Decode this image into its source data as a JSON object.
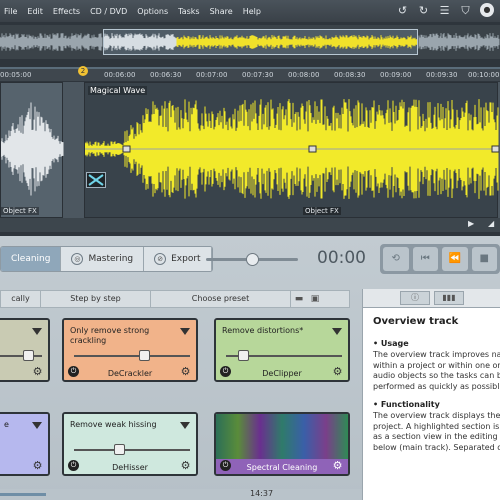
{
  "menubar": {
    "items": [
      "File",
      "Edit",
      "Effects",
      "CD / DVD",
      "Options",
      "Tasks",
      "Share",
      "Help"
    ]
  },
  "timeline": {
    "ticks": [
      "00:05:00",
      "00:06:00",
      "00:06:30",
      "00:07:00",
      "00:07:30",
      "00:08:00",
      "00:08:30",
      "00:09:00",
      "00:09:30",
      "00:10:00"
    ],
    "marker": "2"
  },
  "editor": {
    "clip1_fx": "Object FX",
    "clip2_title": "Magical Wave",
    "clip2_fx": "Object FX"
  },
  "tabs": {
    "cleaning": "Cleaning",
    "mastering": "Mastering",
    "export": "Export"
  },
  "time_display": "00:00",
  "subtabs": {
    "manually": "cally",
    "step": "Step by step",
    "preset": "Choose preset"
  },
  "cards": {
    "decrackler": {
      "title": "Only remove strong crackling",
      "label": "DeCrackler",
      "color": "#f1b38a",
      "level": 0.55
    },
    "declipper": {
      "title": "Remove distortions*",
      "label": "DeClipper",
      "color": "#b7d79a",
      "level": 0.1
    },
    "dehisser": {
      "title": "Remove weak hissing",
      "label": "DeHisser",
      "color": "#cfe8de",
      "level": 0.4
    },
    "spectral": {
      "label": "Spectral Cleaning"
    },
    "left_top": {
      "color": "#c9cbb3",
      "level": 0.75
    },
    "left_bottom": {
      "title": "e",
      "color": "#b6b8ee"
    }
  },
  "info": {
    "title": "Overview track",
    "usage_head": "• Usage",
    "usage_lines": [
      "The overview track improves nav",
      "within a project or within one or",
      "audio objects so the tasks can be",
      "performed as quickly as possible."
    ],
    "func_head": "• Functionality",
    "func_lines": [
      "The overview track displays the e",
      "project. A highlighted section is c",
      "as a section view in the editing tr",
      "below (main track). Separated ob"
    ]
  },
  "status": {
    "time": "14:37"
  }
}
